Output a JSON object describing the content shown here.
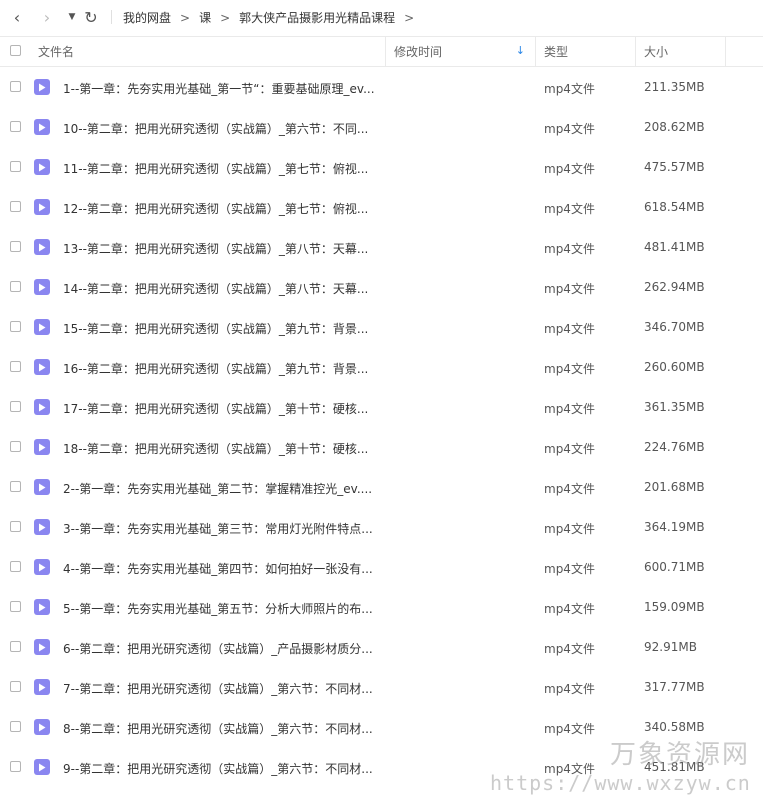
{
  "toolbar": {
    "back_icon": "‹",
    "forward_icon": "›",
    "dropdown_icon": "▼",
    "refresh_icon": "↻",
    "breadcrumb": [
      "我的网盘",
      "课",
      "郭大侠产品摄影用光精品课程"
    ],
    "breadcrumb_sep": ">"
  },
  "header": {
    "name": "文件名",
    "modified": "修改时间",
    "type": "类型",
    "size": "大小",
    "sort_icon": "↓"
  },
  "files": [
    {
      "name": "1--第一章：先夯实用光基础_第一节“：重要基础原理_ev...",
      "type": "mp4文件",
      "size": "211.35MB"
    },
    {
      "name": "10--第二章：把用光研究透彻（实战篇）_第六节：不同...",
      "type": "mp4文件",
      "size": "208.62MB"
    },
    {
      "name": "11--第二章：把用光研究透彻（实战篇）_第七节：俯视...",
      "type": "mp4文件",
      "size": "475.57MB"
    },
    {
      "name": "12--第二章：把用光研究透彻（实战篇）_第七节：俯视...",
      "type": "mp4文件",
      "size": "618.54MB"
    },
    {
      "name": "13--第二章：把用光研究透彻（实战篇）_第八节：天幕...",
      "type": "mp4文件",
      "size": "481.41MB"
    },
    {
      "name": "14--第二章：把用光研究透彻（实战篇）_第八节：天幕...",
      "type": "mp4文件",
      "size": "262.94MB"
    },
    {
      "name": "15--第二章：把用光研究透彻（实战篇）_第九节：背景...",
      "type": "mp4文件",
      "size": "346.70MB"
    },
    {
      "name": "16--第二章：把用光研究透彻（实战篇）_第九节：背景...",
      "type": "mp4文件",
      "size": "260.60MB"
    },
    {
      "name": "17--第二章：把用光研究透彻（实战篇）_第十节：硬核...",
      "type": "mp4文件",
      "size": "361.35MB"
    },
    {
      "name": "18--第二章：把用光研究透彻（实战篇）_第十节：硬核...",
      "type": "mp4文件",
      "size": "224.76MB"
    },
    {
      "name": "2--第一章：先夯实用光基础_第二节：掌握精准控光_ev....",
      "type": "mp4文件",
      "size": "201.68MB"
    },
    {
      "name": "3--第一章：先夯实用光基础_第三节：常用灯光附件特点...",
      "type": "mp4文件",
      "size": "364.19MB"
    },
    {
      "name": "4--第一章：先夯实用光基础_第四节：如何拍好一张没有...",
      "type": "mp4文件",
      "size": "600.71MB"
    },
    {
      "name": "5--第一章：先夯实用光基础_第五节：分析大师照片的布...",
      "type": "mp4文件",
      "size": "159.09MB"
    },
    {
      "name": "6--第二章：把用光研究透彻（实战篇）_产品摄影材质分...",
      "type": "mp4文件",
      "size": "92.91MB"
    },
    {
      "name": "7--第二章：把用光研究透彻（实战篇）_第六节：不同材...",
      "type": "mp4文件",
      "size": "317.77MB"
    },
    {
      "name": "8--第二章：把用光研究透彻（实战篇）_第六节：不同材...",
      "type": "mp4文件",
      "size": "340.58MB"
    },
    {
      "name": "9--第二章：把用光研究透彻（实战篇）_第六节：不同材...",
      "type": "mp4文件",
      "size": "451.81MB"
    }
  ],
  "watermark": {
    "text": "万象资源网",
    "url": "https://www.wxzyw.cn"
  },
  "colors": {
    "file_icon": "#8a86f0",
    "accent": "#2a86e6"
  }
}
